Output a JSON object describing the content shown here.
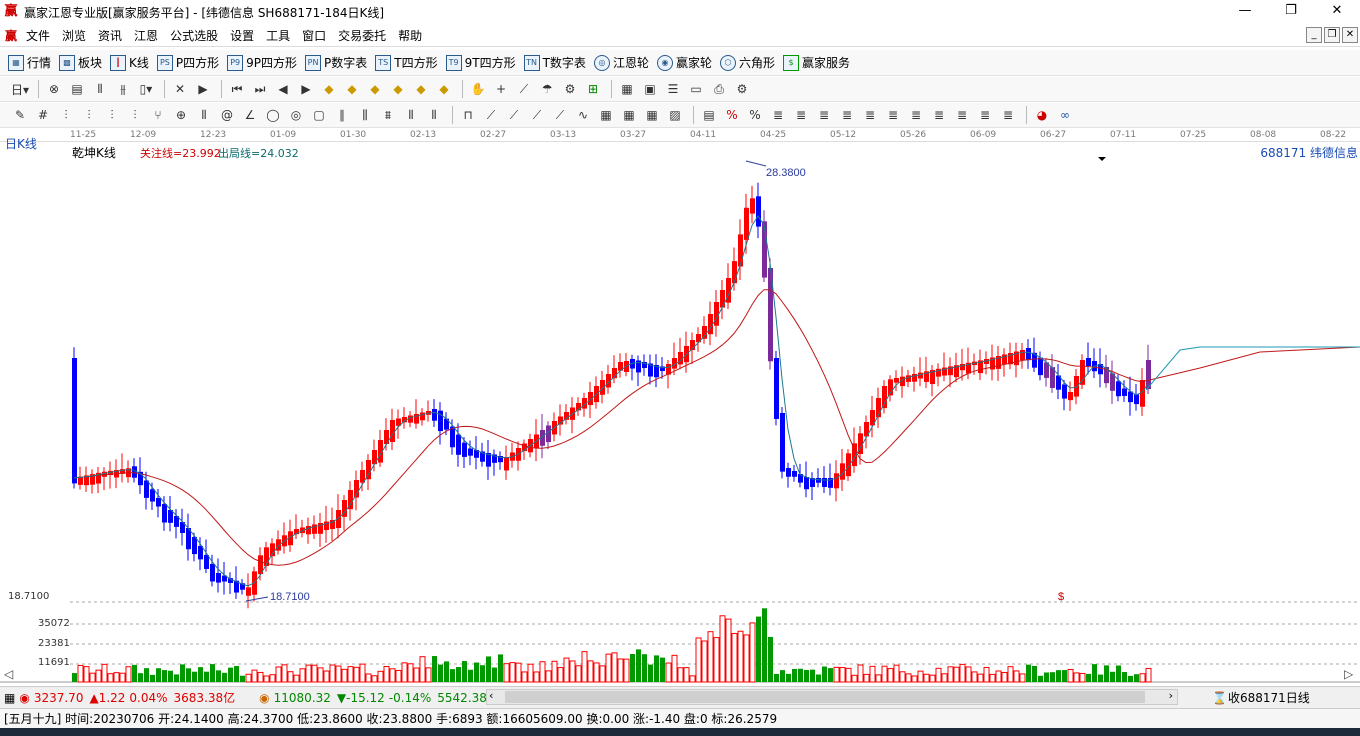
{
  "window": {
    "title": "赢家江恩专业版[赢家服务平台] - [纬德信息  SH688171-184日K线]",
    "buttons": [
      "—",
      "❐",
      "✕"
    ]
  },
  "menu": {
    "items": [
      "文件",
      "浏览",
      "资讯",
      "江恩",
      "公式选股",
      "设置",
      "工具",
      "窗口",
      "交易委托",
      "帮助"
    ]
  },
  "toolbar1": {
    "items": [
      {
        "icon": "grid-icon",
        "label": "行情"
      },
      {
        "icon": "blocks-icon",
        "label": "板块"
      },
      {
        "icon": "candle-icon",
        "label": "K线"
      },
      {
        "icon": "ps-icon",
        "label": "P四方形"
      },
      {
        "icon": "p9-icon",
        "label": "9P四方形"
      },
      {
        "icon": "pn-icon",
        "label": "P数字表"
      },
      {
        "icon": "ts-icon",
        "label": "T四方形"
      },
      {
        "icon": "t9-icon",
        "label": "9T四方形"
      },
      {
        "icon": "tn-icon",
        "label": "T数字表"
      },
      {
        "icon": "wheel-icon",
        "label": "江恩轮"
      },
      {
        "icon": "wheel2-icon",
        "label": "赢家轮"
      },
      {
        "icon": "hexagon-icon",
        "label": "六角形"
      },
      {
        "icon": "dollar-icon",
        "label": "赢家服务"
      }
    ]
  },
  "chart": {
    "period_label": "日K线",
    "indicator_name": "乾坤K线",
    "focus_line": "关注线=23.992",
    "exit_line": "出局线=24.032",
    "stock_name": "688171  纬德信息",
    "high_label": "28.3800",
    "low_label": "18.7100",
    "price_axis_label": "18.7100",
    "vol_labels": [
      "35072",
      "23381",
      "11691"
    ],
    "dollar_marker": "$",
    "dates": [
      "11-25",
      "12-09",
      "12-23",
      "01-09",
      "01-30",
      "02-13",
      "02-27",
      "03-13",
      "03-27",
      "04-11",
      "04-25",
      "05-12",
      "05-26",
      "06-09",
      "06-27",
      "07-11",
      "07-25",
      "08-08",
      "08-22"
    ]
  },
  "status": {
    "index1_value": "3237.70",
    "index1_change": "▲1.22",
    "index1_pct": "0.04%",
    "index1_amount": "3683.38亿",
    "index2_value": "11080.32",
    "index2_change": "▼-15.12",
    "index2_pct": "-0.14%",
    "index2_amount": "5542.38",
    "right_text": "收688171日线",
    "bar_info": "[五月十九] 时间:20230706 开:24.1400 高:24.3700 低:23.8600 收:23.8800 手:6893 额:16605609.00 换:0.00 涨:-1.40 盘:0 标:26.2579"
  },
  "colors": {
    "up": "#ff0000",
    "down": "#0000ff",
    "special": "#7b2a9c",
    "ma_short": "#1b7a8a",
    "ma_long": "#c01818",
    "vol_up": "#ff0000",
    "vol_down": "#009900"
  }
}
